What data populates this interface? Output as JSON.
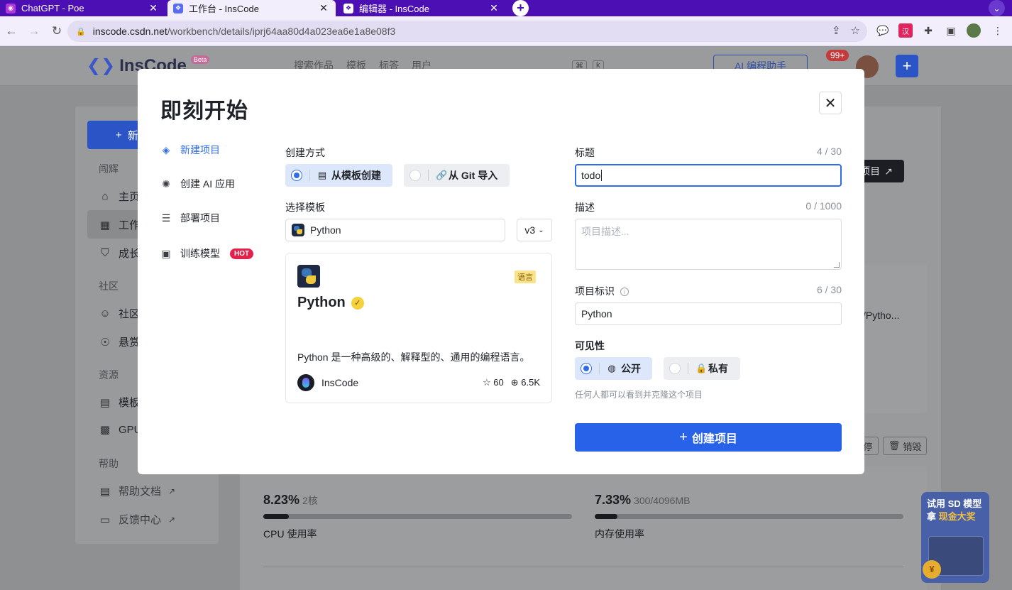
{
  "browser": {
    "tabs": [
      {
        "title": "ChatGPT - Poe",
        "favicon": "poe-icon"
      },
      {
        "title": "工作台 - InsCode",
        "favicon": "inscode-icon"
      },
      {
        "title": "编辑器 - InsCode",
        "favicon": "inscode-icon"
      }
    ],
    "active_tab_index": 1,
    "url_host": "inscode.csdn.net",
    "url_path": "/workbench/details/iprj64aa80d4a023ea6e1a8e08f3"
  },
  "background": {
    "logo_text": "InsCode",
    "logo_badge": "Beta",
    "search_items": [
      "搜索作品",
      "模板",
      "标答",
      "用户"
    ],
    "search_kbd": [
      "⌘",
      "k"
    ],
    "ai_button": "AI 编程助手",
    "notifications": "99+",
    "new_button": "新",
    "sidebar": {
      "groups": [
        "闯辉",
        "社区",
        "资源",
        "帮助"
      ],
      "items": [
        "主页",
        "工作",
        "成长",
        "社区",
        "悬赏",
        "模板",
        "GPU",
        "帮助文档",
        "反馈中心"
      ]
    },
    "dark_button": "项目",
    "python_path": "/Pytho...",
    "stop_button": "停",
    "destroy_button": "销毁",
    "cpu": {
      "value": "8.23%",
      "detail": "2核",
      "label": "CPU 使用率",
      "fraction": 0.0823
    },
    "memory": {
      "value": "7.33%",
      "detail": "300/4096MB",
      "label": "内存使用率",
      "fraction": 0.0733
    },
    "promo": {
      "line1": "试用 SD 模型",
      "line2a": "拿",
      "line2b": "现金大奖"
    }
  },
  "modal": {
    "title": "即刻开始",
    "menu": [
      {
        "label": "新建项目",
        "icon": "layers-icon",
        "active": true
      },
      {
        "label": "创建 AI 应用",
        "icon": "openai-icon",
        "active": false
      },
      {
        "label": "部署项目",
        "icon": "server-icon",
        "active": false
      },
      {
        "label": "训练模型",
        "icon": "chip-icon",
        "active": false,
        "badge": "HOT"
      }
    ],
    "create_method": {
      "label": "创建方式",
      "options": [
        "从模板创建",
        "从 Git 导入"
      ],
      "selected": 0
    },
    "template": {
      "label": "选择模板",
      "search_value": "Python",
      "version": "v3",
      "card": {
        "name": "Python",
        "tag": "语言",
        "description": "Python 是一种高级的、解释型的、通用的编程语言。",
        "author": "InsCode",
        "stars": "60",
        "forks": "6.5K"
      }
    },
    "title_field": {
      "label": "标题",
      "count": "4 / 30",
      "value": "todo"
    },
    "description_field": {
      "label": "描述",
      "count": "0 / 1000",
      "placeholder": "项目描述..."
    },
    "identifier_field": {
      "label": "项目标识",
      "count": "6 / 30",
      "value": "Python"
    },
    "visibility": {
      "label": "可见性",
      "options": [
        "公开",
        "私有"
      ],
      "selected": 0,
      "hint": "任何人都可以看到并克隆这个项目"
    },
    "submit_button": "创建项目"
  }
}
